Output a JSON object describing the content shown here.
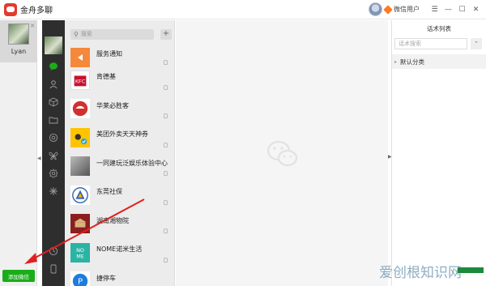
{
  "app": {
    "title": "金舟多聊"
  },
  "user": {
    "name": "微信用户"
  },
  "window_controls": [
    "☰",
    "—",
    "☐",
    "✕"
  ],
  "account": {
    "name": "Lyan",
    "close": "✕",
    "add_button": "添加微信"
  },
  "search": {
    "placeholder": "搜索",
    "add": "+"
  },
  "nav_icons": [
    "chat-icon",
    "contacts-icon",
    "cube-icon",
    "folder-icon",
    "settings-gear-icon",
    "butterfly-icon",
    "gear-icon",
    "star-icon",
    "history-icon",
    "phone-icon"
  ],
  "chats": [
    {
      "name": "服务通知",
      "icon": "service-notice-icon",
      "color": "#f5883b"
    },
    {
      "name": "肯德基",
      "icon": "kfc-logo-icon",
      "color": "#c8102e"
    },
    {
      "name": "华莱必胜客",
      "icon": "pizza-hut-logo-icon",
      "color": "#d32f2f"
    },
    {
      "name": "美团外卖天天神券",
      "icon": "meituan-icon",
      "color": "#ffc300"
    },
    {
      "name": "一同建玩泛娱乐体验中心",
      "icon": "avatar-photo-icon",
      "color": "#888888"
    },
    {
      "name": "东莞社保",
      "icon": "social-security-icon",
      "color": "#2f5fb3"
    },
    {
      "name": "湖南湘物院",
      "icon": "museum-icon",
      "color": "#8b1e1e"
    },
    {
      "name": "NOME诺米生活",
      "icon": "nome-logo-icon",
      "color": "#2bb3a3"
    },
    {
      "name": "捷停车",
      "icon": "parking-icon",
      "color": "#1e7be0"
    }
  ],
  "phrases": {
    "title": "话术列表",
    "search_placeholder": "话术搜索",
    "collapse": "⌃",
    "categories": [
      {
        "label": "默认分类",
        "arrow": "▸"
      }
    ]
  },
  "watermark": {
    "text": "爱创根知识网"
  },
  "colors": {
    "accent_green": "#1aad19",
    "rail": "#2e2e2e",
    "annotation": "#e02020"
  }
}
